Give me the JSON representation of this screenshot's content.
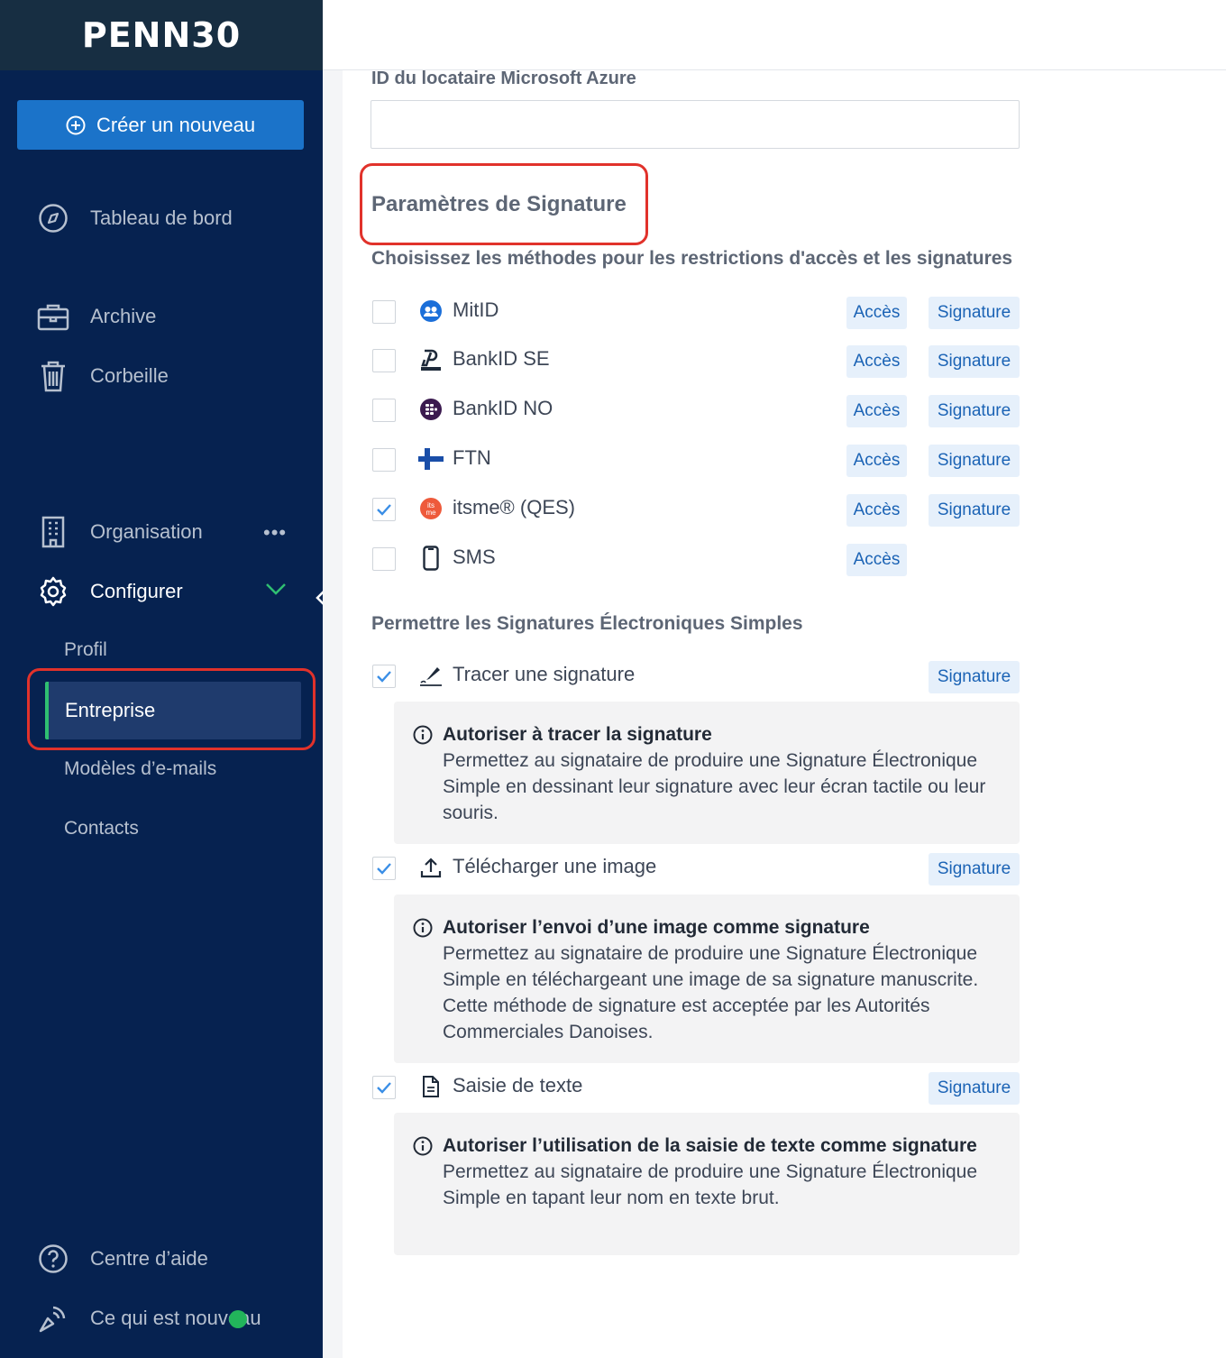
{
  "sidebar": {
    "logo": "PENN30",
    "create_button": "Créer un nouveau",
    "nav": {
      "dashboard": "Tableau de bord",
      "archive": "Archive",
      "trash": "Corbeille",
      "organisation": "Organisation",
      "organisation_more": "•••",
      "configure": "Configurer"
    },
    "sub": {
      "profile": "Profil",
      "company": "Entreprise",
      "email_templates": "Modèles d’e-mails",
      "contacts": "Contacts"
    },
    "help": "Centre d’aide",
    "whats_new": "Ce qui est nouveau"
  },
  "form": {
    "azure_label": "ID du locataire Microsoft Azure",
    "azure_value": "",
    "signature_heading": "Paramètres de Signature",
    "methods_label": "Choisissez les méthodes pour les restrictions d'accès et les signatures",
    "methods": [
      {
        "name": "MitID",
        "checked": false,
        "icon": "mitid-icon",
        "acces": "Accès",
        "signature": "Signature"
      },
      {
        "name": "BankID SE",
        "checked": false,
        "icon": "bankid-se-icon",
        "acces": "Accès",
        "signature": "Signature"
      },
      {
        "name": "BankID NO",
        "checked": false,
        "icon": "bankid-no-icon",
        "acces": "Accès",
        "signature": "Signature"
      },
      {
        "name": "FTN",
        "checked": false,
        "icon": "finland-flag-icon",
        "acces": "Accès",
        "signature": "Signature"
      },
      {
        "name": "itsme® (QES)",
        "checked": true,
        "icon": "itsme-icon",
        "acces": "Accès",
        "signature": "Signature"
      },
      {
        "name": "SMS",
        "checked": false,
        "icon": "phone-icon",
        "acces": "Accès"
      }
    ],
    "simple_label": "Permettre les Signatures Électroniques Simples",
    "simple": [
      {
        "name": "Tracer une signature",
        "checked": true,
        "icon": "pen-icon",
        "signature": "Signature",
        "info_title": "Autoriser à tracer la signature",
        "info_text": "Permettez au signataire de produire une Signature Électronique Simple en dessinant leur signature avec leur écran tactile ou leur souris."
      },
      {
        "name": "Télécharger une image",
        "checked": true,
        "icon": "upload-icon",
        "signature": "Signature",
        "info_title": "Autoriser l’envoi d’une image comme signature",
        "info_text": "Permettez au signataire de produire une Signature Électronique Simple en téléchargeant une image de sa signature manuscrite. Cette méthode de signature est acceptée par les Autorités Commerciales Danoises."
      },
      {
        "name": "Saisie de texte",
        "checked": true,
        "icon": "document-icon",
        "signature": "Signature",
        "info_title": "Autoriser l’utilisation de la saisie de texte comme signature",
        "info_text": "Permettez au signataire de produire une Signature Électronique Simple en tapant leur nom en texte brut."
      }
    ]
  },
  "colors": {
    "sidebar_bg": "#062250",
    "primary": "#1b73c9",
    "tag_bg": "#e6f0fb",
    "tag_text": "#1b63b5",
    "active_indicator": "#2fbf71",
    "highlight": "#e1322b"
  }
}
